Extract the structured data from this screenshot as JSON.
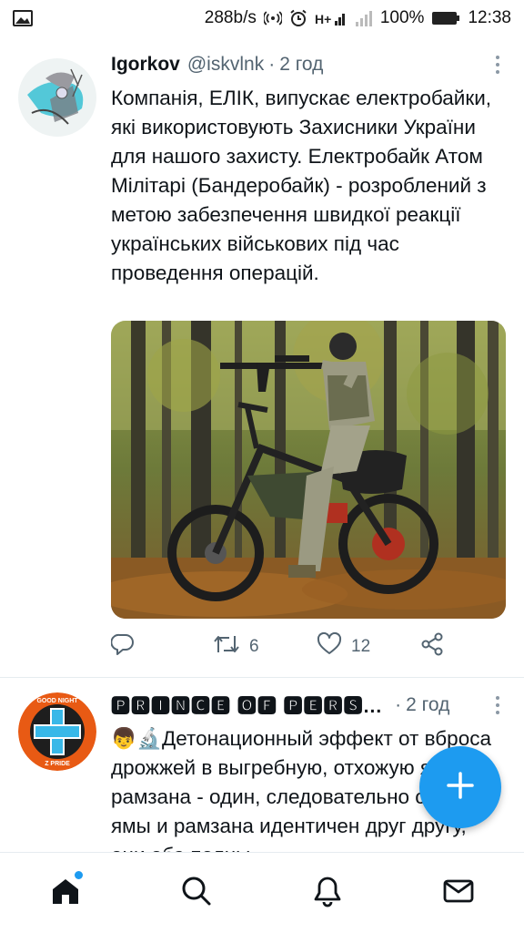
{
  "status_bar": {
    "network_speed": "288b/s",
    "battery": "100%",
    "time": "12:38",
    "icons": [
      "gallery-icon",
      "hotspot-icon",
      "alarm-icon",
      "hplus-signal-icon",
      "signal-bars-icon",
      "battery-icon"
    ]
  },
  "tweets": [
    {
      "name": "Igorkov",
      "handle": "@iskvlnk",
      "separator": "·",
      "time": "2 год",
      "text": "Компанія, ЕЛІК, випускає електробайки, які використовують Захисники України для нашого захисту. Електробайк Атом Мілітарі (Бандеробайк) - розроблений з метою забезпечення швидкої реакції українських військових під час проведення операцій.",
      "media_icon": "soldier-electric-bike-photo",
      "stats": {
        "retweets": "6",
        "likes": "12"
      }
    },
    {
      "name": "🅿🆁🅸🅽🅲🅴 🅾🅵 🅿🅴🆁🆂...",
      "separator": "·",
      "time": "2 год",
      "text": "👦🔬Детонационный эффект от вброса дрожжей в выгребную, отхожую яму и в рамзана - один, следовательно состав ямы и рамзана идентичен друг другу, они оба полны",
      "avatar_label_top": "GOOD NIGHT",
      "avatar_label_bottom": "Z PRIDE"
    }
  ],
  "fab": {
    "icon": "compose-plus-icon"
  },
  "bottom_nav": [
    "home-icon",
    "search-icon",
    "notifications-icon",
    "messages-icon"
  ],
  "colors": {
    "accent": "#1d9bf0",
    "text": "#0f1419",
    "secondary": "#536471"
  }
}
